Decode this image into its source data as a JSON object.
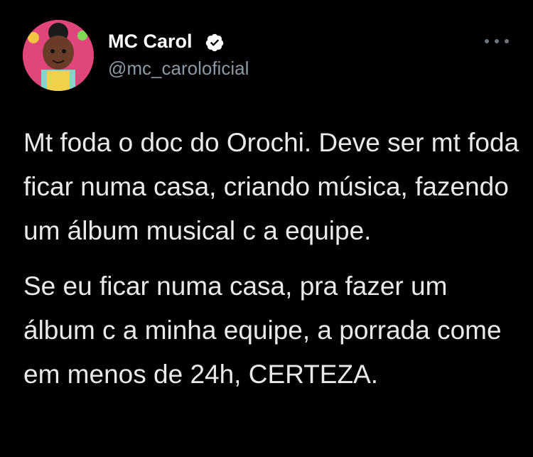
{
  "author": {
    "display_name": "MC Carol",
    "handle": "@mc_caroloficial",
    "verified": true,
    "avatar_icon": "profile-avatar"
  },
  "tweet": {
    "paragraphs": [
      "Mt foda o doc do Orochi. Deve ser mt foda ficar numa casa, criando música, fazendo um álbum musical c a equipe.",
      "Se eu ficar numa casa, pra fazer um álbum c a minha equipe, a porrada come em menos de 24h, CERTEZA."
    ]
  },
  "colors": {
    "background": "#000000",
    "text": "#e7e9ea",
    "secondary": "#8b98a5",
    "verified_badge": "#ffffff"
  }
}
